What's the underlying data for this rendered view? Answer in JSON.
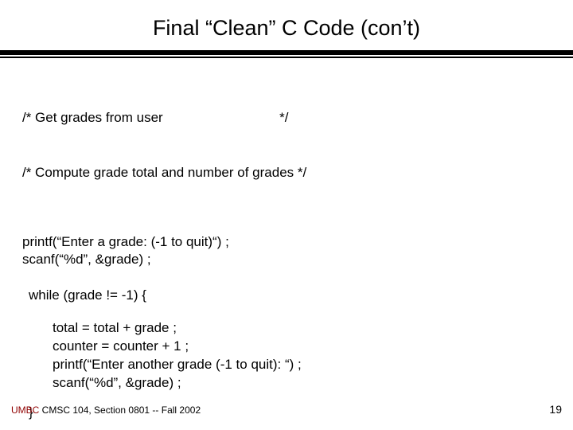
{
  "title": "Final “Clean” C Code (con’t)",
  "comment1": "/* Get grades from user                               */",
  "comment2": "/* Compute grade total and number of grades */",
  "printf1": "printf(“Enter a grade: (-1 to quit)“) ;",
  "scanf1": "scanf(“%d”, &grade) ;",
  "while": "while (grade != -1) {",
  "body1": "total = total + grade ;",
  "body2": "counter = counter + 1 ;",
  "body3": "printf(“Enter another grade (-1 to quit): “) ;",
  "body4": "scanf(“%d”, &grade) ;",
  "close": "}",
  "footer": {
    "umbc": "UMBC",
    "course": " CMSC 104, Section 0801 -- Fall 2002",
    "page": "19"
  }
}
